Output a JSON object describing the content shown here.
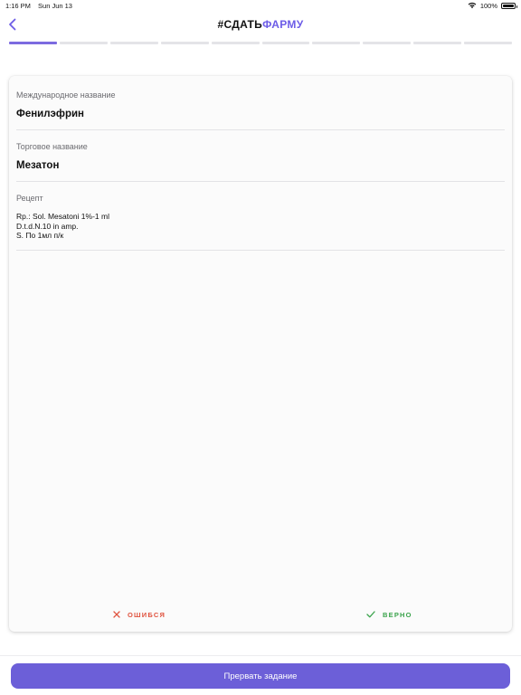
{
  "status_bar": {
    "time": "1:16 PM",
    "date": "Sun Jun 13",
    "battery": "100%"
  },
  "header": {
    "title_part_1": "#СДАТЬ",
    "title_part_2": "ФАРМУ",
    "accent_color": "#6c5ce7"
  },
  "progress": {
    "total_steps": 10,
    "current_step": 1
  },
  "card": {
    "fields": [
      {
        "label": "Международное название",
        "value": "Фенилэфрин"
      },
      {
        "label": "Торговое название",
        "value": "Мезатон"
      }
    ],
    "recipe": {
      "label": "Рецепт",
      "lines": [
        "Rp.: Sol. Mesatoni 1%-1 ml",
        "D.t.d.N.10 in amp.",
        "S. По 1мл п/к"
      ]
    }
  },
  "actions": {
    "wrong_label": "ОШИБСЯ",
    "wrong_color": "#e0533f",
    "right_label": "ВЕРНО",
    "right_color": "#3aa34b"
  },
  "footer": {
    "abort_label": "Прервать задание"
  }
}
